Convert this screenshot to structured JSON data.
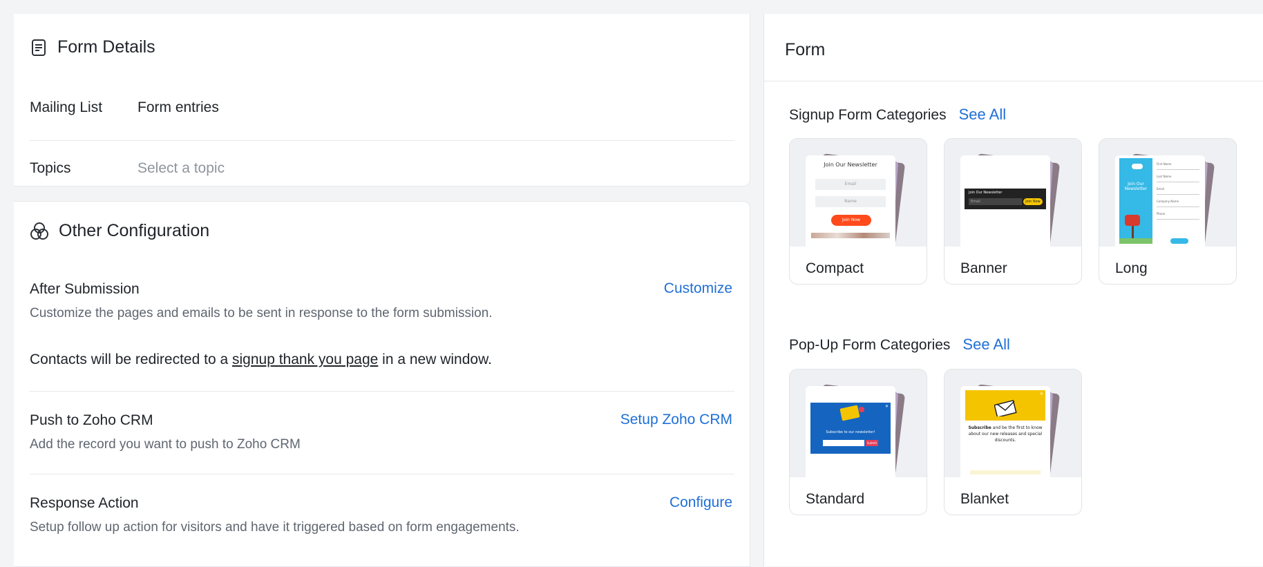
{
  "form_details": {
    "title": "Form Details",
    "mailing_list_label": "Mailing List",
    "mailing_list_value": "Form entries",
    "topics_label": "Topics",
    "topics_placeholder": "Select a topic"
  },
  "other_config": {
    "title": "Other Configuration",
    "after_submission": {
      "title": "After Submission",
      "description": "Customize the pages and emails to be sent in response to the form submission.",
      "action": "Customize",
      "redirect_prefix": "Contacts will be redirected to a",
      "redirect_link": "signup thank you page",
      "redirect_suffix": "in a new window."
    },
    "push_crm": {
      "title": "Push to Zoho CRM",
      "description": "Add the record you want to push to Zoho CRM",
      "action": "Setup Zoho CRM"
    },
    "response_action": {
      "title": "Response Action",
      "description": "Setup follow up action for visitors and have it triggered based on form engagements.",
      "action": "Configure"
    }
  },
  "form_panel": {
    "title": "Form",
    "signup": {
      "title": "Signup Form Categories",
      "see_all": "See All",
      "cards": [
        {
          "label": "Compact",
          "preview": {
            "heading": "Join Our Newsletter",
            "f1": "Email",
            "f2": "Name",
            "btn": "Join Now"
          }
        },
        {
          "label": "Banner",
          "preview": {
            "heading": "Join Our Newsletter",
            "f1": "Email",
            "btn": "Join Now"
          }
        },
        {
          "label": "Long",
          "preview": {
            "heading": "Join Our Newsletter",
            "f1": "First Name",
            "f2": "Last Name",
            "f3": "Email",
            "f4": "Company Name",
            "f5": "Phone"
          }
        }
      ]
    },
    "popup": {
      "title": "Pop-Up Form Categories",
      "see_all": "See All",
      "cards": [
        {
          "label": "Standard",
          "preview": {
            "heading": "Subscribe to our newsletter!",
            "btn": "Submit"
          }
        },
        {
          "label": "Blanket",
          "preview": {
            "strong": "Subscribe",
            "rest": "and be the first to know about our new releases and special discounts."
          }
        }
      ]
    }
  },
  "colors": {
    "link": "#1f6fd6",
    "text": "#1f2329",
    "muted": "#5f6670",
    "placeholder": "#8f959e",
    "accent_orange": "#ff5a1f",
    "accent_yellow": "#f5c400",
    "accent_blue": "#1565c0"
  },
  "icons": {
    "form_details": "document-icon",
    "other_config": "overlapping-circles-icon"
  }
}
